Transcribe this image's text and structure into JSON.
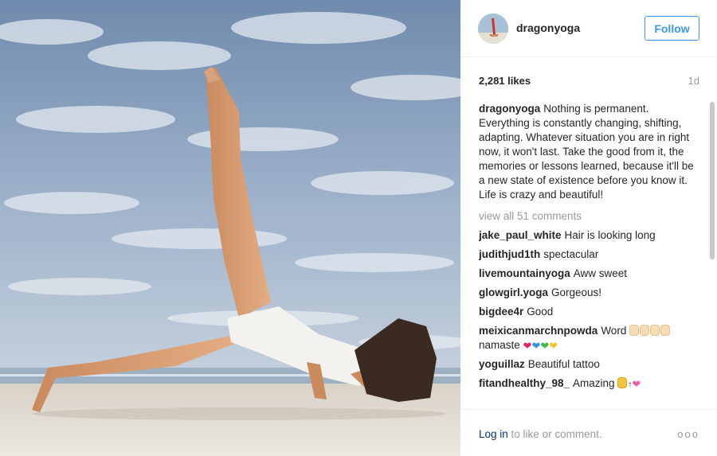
{
  "post": {
    "username": "dragonyoga",
    "follow_label": "Follow",
    "likes": "2,281 likes",
    "age": "1d",
    "caption_user": "dragonyoga",
    "caption_text": "Nothing is permanent. Everything is constantly changing, shifting, adapting. Whatever situation you are in right now, it won't last. Take the good from it, the memories or lessons learned, because it'll be a new state of existence before you know it. Life is crazy and beautiful!",
    "view_all": "view all 51 comments"
  },
  "comments": [
    {
      "user": "jake_paul_white",
      "text": "Hair is looking long"
    },
    {
      "user": "judithjud1th",
      "text": "spectacular"
    },
    {
      "user": "livemountainyoga",
      "text": "Aww sweet"
    },
    {
      "user": "glowgirl.yoga",
      "text": "Gorgeous!"
    },
    {
      "user": "bigdee4r",
      "text": "Good"
    },
    {
      "user": "meixicanmarchnpowda",
      "text": "Word",
      "text2": "namaste"
    },
    {
      "user": "yoguillaz",
      "text": "Beautiful tattoo"
    },
    {
      "user": "fitandhealthy_98_",
      "text": "Amazing"
    }
  ],
  "footer": {
    "login_link": "Log in",
    "login_rest": " to like or comment.",
    "more": "ooo"
  },
  "colors": {
    "accent": "#3897f0",
    "link": "#003569",
    "muted": "#999999"
  },
  "icons": {
    "praying_hands": "praying-hands-emoji",
    "hearts": "hearts-emoji",
    "raised_hands": "raised-hands-emoji",
    "top_arrow": "top-arrow-emoji"
  }
}
